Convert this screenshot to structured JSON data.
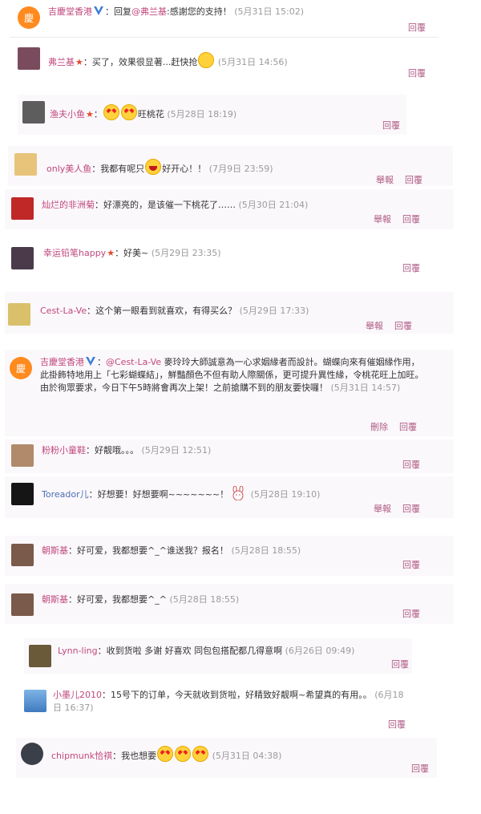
{
  "colors": {
    "accent": "#c0487d",
    "time": "#9b9b9b",
    "card": "#fbf8fb"
  },
  "labels": {
    "reply": "回覆",
    "report": "舉報",
    "delete": "刪除"
  },
  "comments": [
    {
      "name": "吉慶堂香港",
      "verified": true,
      "pre": "：回复",
      "mention": "@弗兰基",
      "post": ":感謝您的支持！",
      "time": "(5月31日 15:02)",
      "avatar_text": "慶",
      "avatar_color": "#ff8a1e"
    },
    {
      "name": "弗兰基",
      "star": true,
      "text": "：买了，效果很显著...赶快抢",
      "emoji": "thinking-emoji",
      "time": "(5月31日 14:56)",
      "avatar_color": "#7a4b5c"
    },
    {
      "name": "渔夫小鱼",
      "star": true,
      "text": "：",
      "emoji": "heart-eyes-emoji x2",
      "post": "旺桃花",
      "time": "(5月28日 18:19)",
      "avatar_color": "#5d5d5d"
    },
    {
      "name": "only美人鱼",
      "text": "：我都有呢只",
      "emoji": "big-grin-emoji",
      "post": "好开心！！",
      "time": "(7月9日 23:59)",
      "avatar_color": "#e8c47a"
    },
    {
      "name": "灿烂的非洲菊",
      "text": "：好漂亮的，是该催一下桃花了……",
      "time": "(5月30日 21:04)",
      "avatar_color": "#c02828"
    },
    {
      "name": "幸运铅笔happy",
      "star": true,
      "text": "：好美~",
      "time": "(5月29日 23:35)",
      "avatar_color": "#4a3a4a"
    },
    {
      "name": "Cest-La-Ve",
      "text": "：这个第一眼看到就喜欢，有得买么？",
      "time": "(5月29日 17:33)",
      "avatar_color": "#d9c06a"
    },
    {
      "name": "吉慶堂香港",
      "verified": true,
      "pre": "：",
      "mention": "@Cest-La-Ve",
      "post": " 麥玲玲大師誠意為一心求姻緣者而設計。蝴蝶向來有催姻緣作用，此掛飾特地用上「七彩蝴蝶結」，鮮豔顏色不但有助人際關係，更可提升異性緣，令桃花旺上加旺。由於徇眾要求，今日下午5時將會再次上架！之前搶購不到的朋友要快囉！",
      "time": "(5月31日 14:57)",
      "avatar_text": "慶",
      "avatar_color": "#ff8a1e"
    },
    {
      "name": "粉粉小童鞋",
      "text": "：好靓哦。。。",
      "time": "(5月29日 12:51)",
      "avatar_color": "#b08a6a"
    },
    {
      "name": "Toreador儿",
      "text": "：好想要！好想要啊~~~~~~~！",
      "emoji": "rabbit-emoji",
      "time": "(5月28日 19:10)",
      "avatar_color": "#151515"
    },
    {
      "name": "朝斯基",
      "text": "：好可爱，我都想要^_^谁送我？报名！",
      "time": "(5月28日 18:55)",
      "avatar_color": "#7a5a4a"
    },
    {
      "name": "朝斯基",
      "text": "：好可爱，我都想要^_^",
      "time": "(5月28日 18:55)",
      "avatar_color": "#7a5a4a"
    },
    {
      "name": "Lynn-ling",
      "text": "：收到货啦 多谢 好喜欢 同包包搭配都几得意啊",
      "time": "(6月26日 09:49)",
      "avatar_color": "#6a5a3a"
    },
    {
      "name": "小墨儿2010",
      "text": "：15号下的订单，今天就收到货啦，好精致好靓啊~希望真的有用。。",
      "time": "(6月18日 16:37)",
      "avatar_color": "#5a8fc9"
    },
    {
      "name": "chipmunk恰祺",
      "text": "：我也想要",
      "emoji": "heart-eyes-emoji x3",
      "time": "(5月31日 04:38)",
      "avatar_color": "#3a3f4a"
    }
  ]
}
